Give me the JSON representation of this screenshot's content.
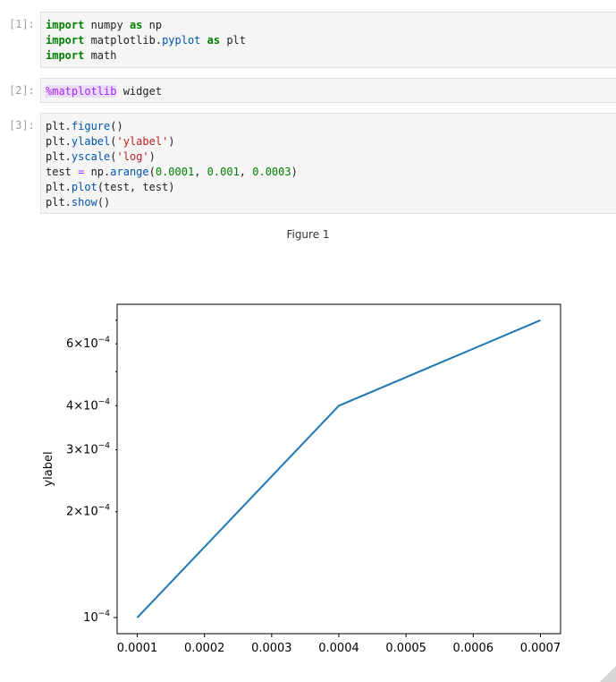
{
  "cells": [
    {
      "prompt": "[1]:",
      "lines": [
        [
          [
            "kw",
            "import"
          ],
          [
            "p",
            " numpy "
          ],
          [
            "kw",
            "as"
          ],
          [
            "p",
            " np"
          ]
        ],
        [
          [
            "kw",
            "import"
          ],
          [
            "p",
            " matplotlib."
          ],
          [
            "mod",
            "pyplot"
          ],
          [
            "p",
            " "
          ],
          [
            "kw",
            "as"
          ],
          [
            "p",
            " plt"
          ]
        ],
        [
          [
            "kw",
            "import"
          ],
          [
            "p",
            " math"
          ]
        ]
      ]
    },
    {
      "prompt": "[2]:",
      "lines": [
        [
          [
            "magic",
            "%matplotlib"
          ],
          [
            "p",
            " widget"
          ]
        ]
      ]
    },
    {
      "prompt": "[3]:",
      "lines": [
        [
          [
            "p",
            "plt."
          ],
          [
            "fn",
            "figure"
          ],
          [
            "p",
            "()"
          ]
        ],
        [
          [
            "p",
            "plt."
          ],
          [
            "fn",
            "ylabel"
          ],
          [
            "p",
            "("
          ],
          [
            "str",
            "'ylabel'"
          ],
          [
            "p",
            ")"
          ]
        ],
        [
          [
            "p",
            "plt."
          ],
          [
            "fn",
            "yscale"
          ],
          [
            "p",
            "("
          ],
          [
            "str",
            "'log'"
          ],
          [
            "p",
            ")"
          ]
        ],
        [
          [
            "p",
            "test "
          ],
          [
            "op",
            "="
          ],
          [
            "p",
            " np."
          ],
          [
            "fn",
            "arange"
          ],
          [
            "p",
            "("
          ],
          [
            "num",
            "0.0001"
          ],
          [
            "p",
            ", "
          ],
          [
            "num",
            "0.001"
          ],
          [
            "p",
            ", "
          ],
          [
            "num",
            "0.0003"
          ],
          [
            "p",
            ")"
          ]
        ],
        [
          [
            "p",
            "plt."
          ],
          [
            "fn",
            "plot"
          ],
          [
            "p",
            "(test, test)"
          ]
        ],
        [
          [
            "p",
            "plt."
          ],
          [
            "fn",
            "show"
          ],
          [
            "p",
            "()"
          ]
        ]
      ]
    }
  ],
  "figure": {
    "title": "Figure 1"
  },
  "chart_data": {
    "type": "line",
    "title": "",
    "xlabel": "",
    "ylabel": "ylabel",
    "yscale": "log",
    "x": [
      0.0001,
      0.0004,
      0.0007
    ],
    "series": [
      {
        "values": [
          0.0001,
          0.0004,
          0.0007
        ],
        "color": "#1f77b4"
      }
    ],
    "xlim": [
      7e-05,
      0.00073
    ],
    "ylim": [
      9e-05,
      0.000777
    ],
    "xticks": [
      {
        "value": 0.0001,
        "label": "0.0001"
      },
      {
        "value": 0.0002,
        "label": "0.0002"
      },
      {
        "value": 0.0003,
        "label": "0.0003"
      },
      {
        "value": 0.0004,
        "label": "0.0004"
      },
      {
        "value": 0.0005,
        "label": "0.0005"
      },
      {
        "value": 0.0006,
        "label": "0.0006"
      },
      {
        "value": 0.0007,
        "label": "0.0007"
      }
    ],
    "yticks_major": [
      {
        "value": 0.0001,
        "mantissa": "",
        "exponent": "−4"
      }
    ],
    "yticks_labeled_minor": [
      {
        "value": 0.0002,
        "mantissa": "2",
        "exponent": "−4"
      },
      {
        "value": 0.0003,
        "mantissa": "3",
        "exponent": "−4"
      },
      {
        "value": 0.0004,
        "mantissa": "4",
        "exponent": "−4"
      },
      {
        "value": 0.0006,
        "mantissa": "6",
        "exponent": "−4"
      }
    ],
    "yticks_unlabeled_minor": [
      0.0005,
      0.0007
    ],
    "grid": false
  }
}
